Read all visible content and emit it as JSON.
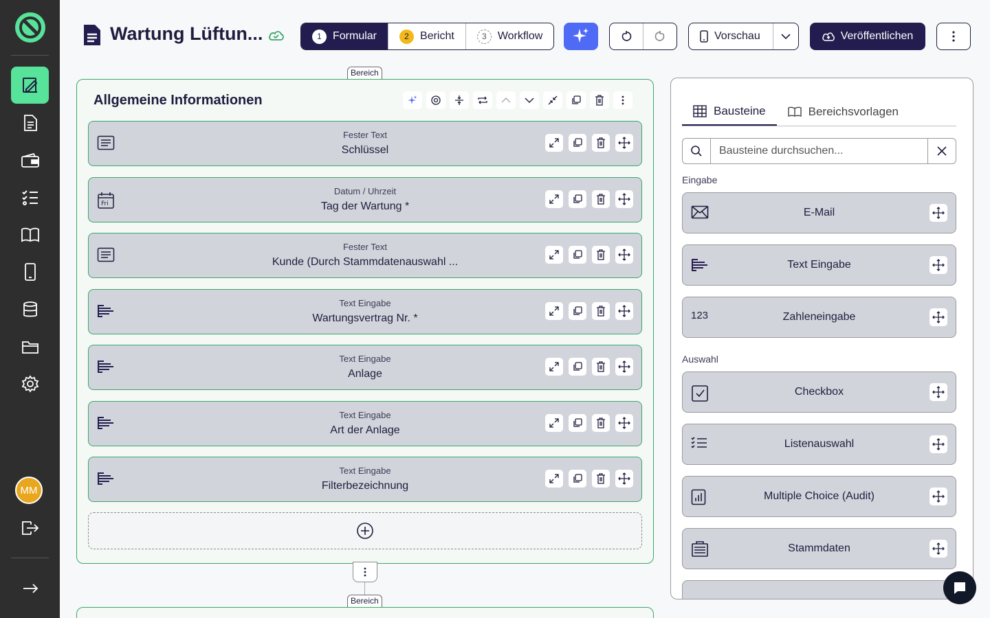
{
  "sidebar": {
    "items": [
      {
        "icon": "form-edit-icon",
        "active": true
      },
      {
        "icon": "report-icon"
      },
      {
        "icon": "wallet-icon"
      },
      {
        "icon": "checklist-icon"
      },
      {
        "icon": "book-icon"
      },
      {
        "icon": "mobile-icon"
      },
      {
        "icon": "database-icon"
      },
      {
        "icon": "folder-icon"
      },
      {
        "icon": "gear-icon"
      }
    ],
    "avatar_initials": "MM",
    "logout_icon": "logout-icon",
    "expand_icon": "arrow-right-icon"
  },
  "header": {
    "title": "Wartung Lüftun...",
    "steps": [
      {
        "num": "1",
        "label": "Formular",
        "active": true
      },
      {
        "num": "2",
        "label": "Bericht"
      },
      {
        "num": "3",
        "label": "Workflow"
      }
    ],
    "preview_label": "Vorschau",
    "publish_label": "Veröffentlichen"
  },
  "section": {
    "tag": "Bereich",
    "title": "Allgemeine Informationen",
    "fields": [
      {
        "type": "Fester Text",
        "label": "Schlüssel",
        "icon": "text-block-icon"
      },
      {
        "type": "Datum / Uhrzeit",
        "label": "Tag der Wartung *",
        "icon": "calendar-icon",
        "icon_text": "Fri"
      },
      {
        "type": "Fester Text",
        "label": "Kunde (Durch Stammdatenauswahl ...",
        "icon": "text-block-icon"
      },
      {
        "type": "Text Eingabe",
        "label": "Wartungsvertrag Nr. *",
        "icon": "text-input-icon"
      },
      {
        "type": "Text Eingabe",
        "label": "Anlage",
        "icon": "text-input-icon"
      },
      {
        "type": "Text Eingabe",
        "label": "Art der Anlage",
        "icon": "text-input-icon"
      },
      {
        "type": "Text Eingabe",
        "label": "Filterbezeichnung",
        "icon": "text-input-icon"
      }
    ]
  },
  "section2": {
    "tag": "Bereich"
  },
  "panel": {
    "tabs": [
      {
        "label": "Bausteine",
        "active": true
      },
      {
        "label": "Bereichsvorlagen"
      }
    ],
    "search": {
      "placeholder": "Bausteine durchsuchen...",
      "value": ""
    },
    "groups": [
      {
        "label": "Eingabe",
        "blocks": [
          {
            "label": "E-Mail",
            "icon": "mail-icon"
          },
          {
            "label": "Text Eingabe",
            "icon": "text-input-icon"
          },
          {
            "label": "Zahleneingabe",
            "icon": "number-icon",
            "icon_text": "123"
          }
        ]
      },
      {
        "label": "Auswahl",
        "blocks": [
          {
            "label": "Checkbox",
            "icon": "checkbox-icon"
          },
          {
            "label": "Listenauswahl",
            "icon": "list-icon"
          },
          {
            "label": "Multiple Choice (Audit)",
            "icon": "audit-chart-icon"
          },
          {
            "label": "Stammdaten",
            "icon": "master-data-icon"
          }
        ]
      }
    ]
  },
  "colors": {
    "accent": "#57e39a",
    "brand_dark": "#231d4f",
    "ai_blue": "#4f6bf5",
    "section_border": "#3ca66b"
  }
}
